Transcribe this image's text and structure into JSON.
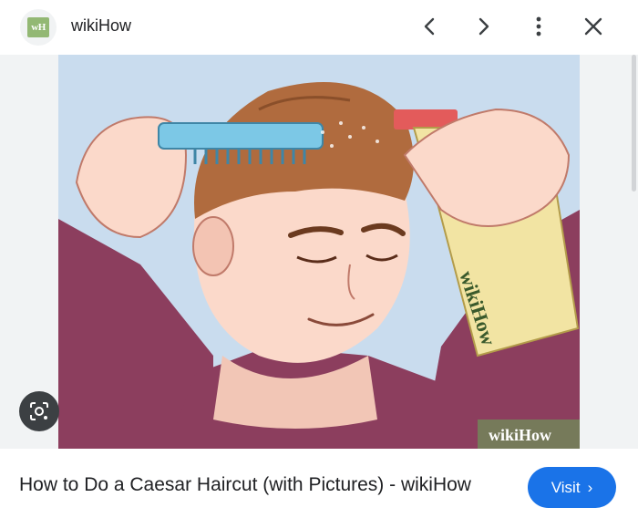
{
  "header": {
    "site_name": "wikiHow",
    "favicon_text": "wH"
  },
  "controls": {
    "prev_icon": "chevron-left-icon",
    "next_icon": "chevron-right-icon",
    "more_icon": "more-vert-icon",
    "close_icon": "close-icon"
  },
  "image": {
    "bottle_label": "wikiHow",
    "watermark": "wikiHow"
  },
  "caption": {
    "title": "How to Do a Caesar Haircut (with Pictures) - wikiHow"
  },
  "actions": {
    "visit_label": "Visit",
    "visit_chevron": "›"
  },
  "colors": {
    "accent": "#1a73e8",
    "favicon": "#93b874"
  }
}
